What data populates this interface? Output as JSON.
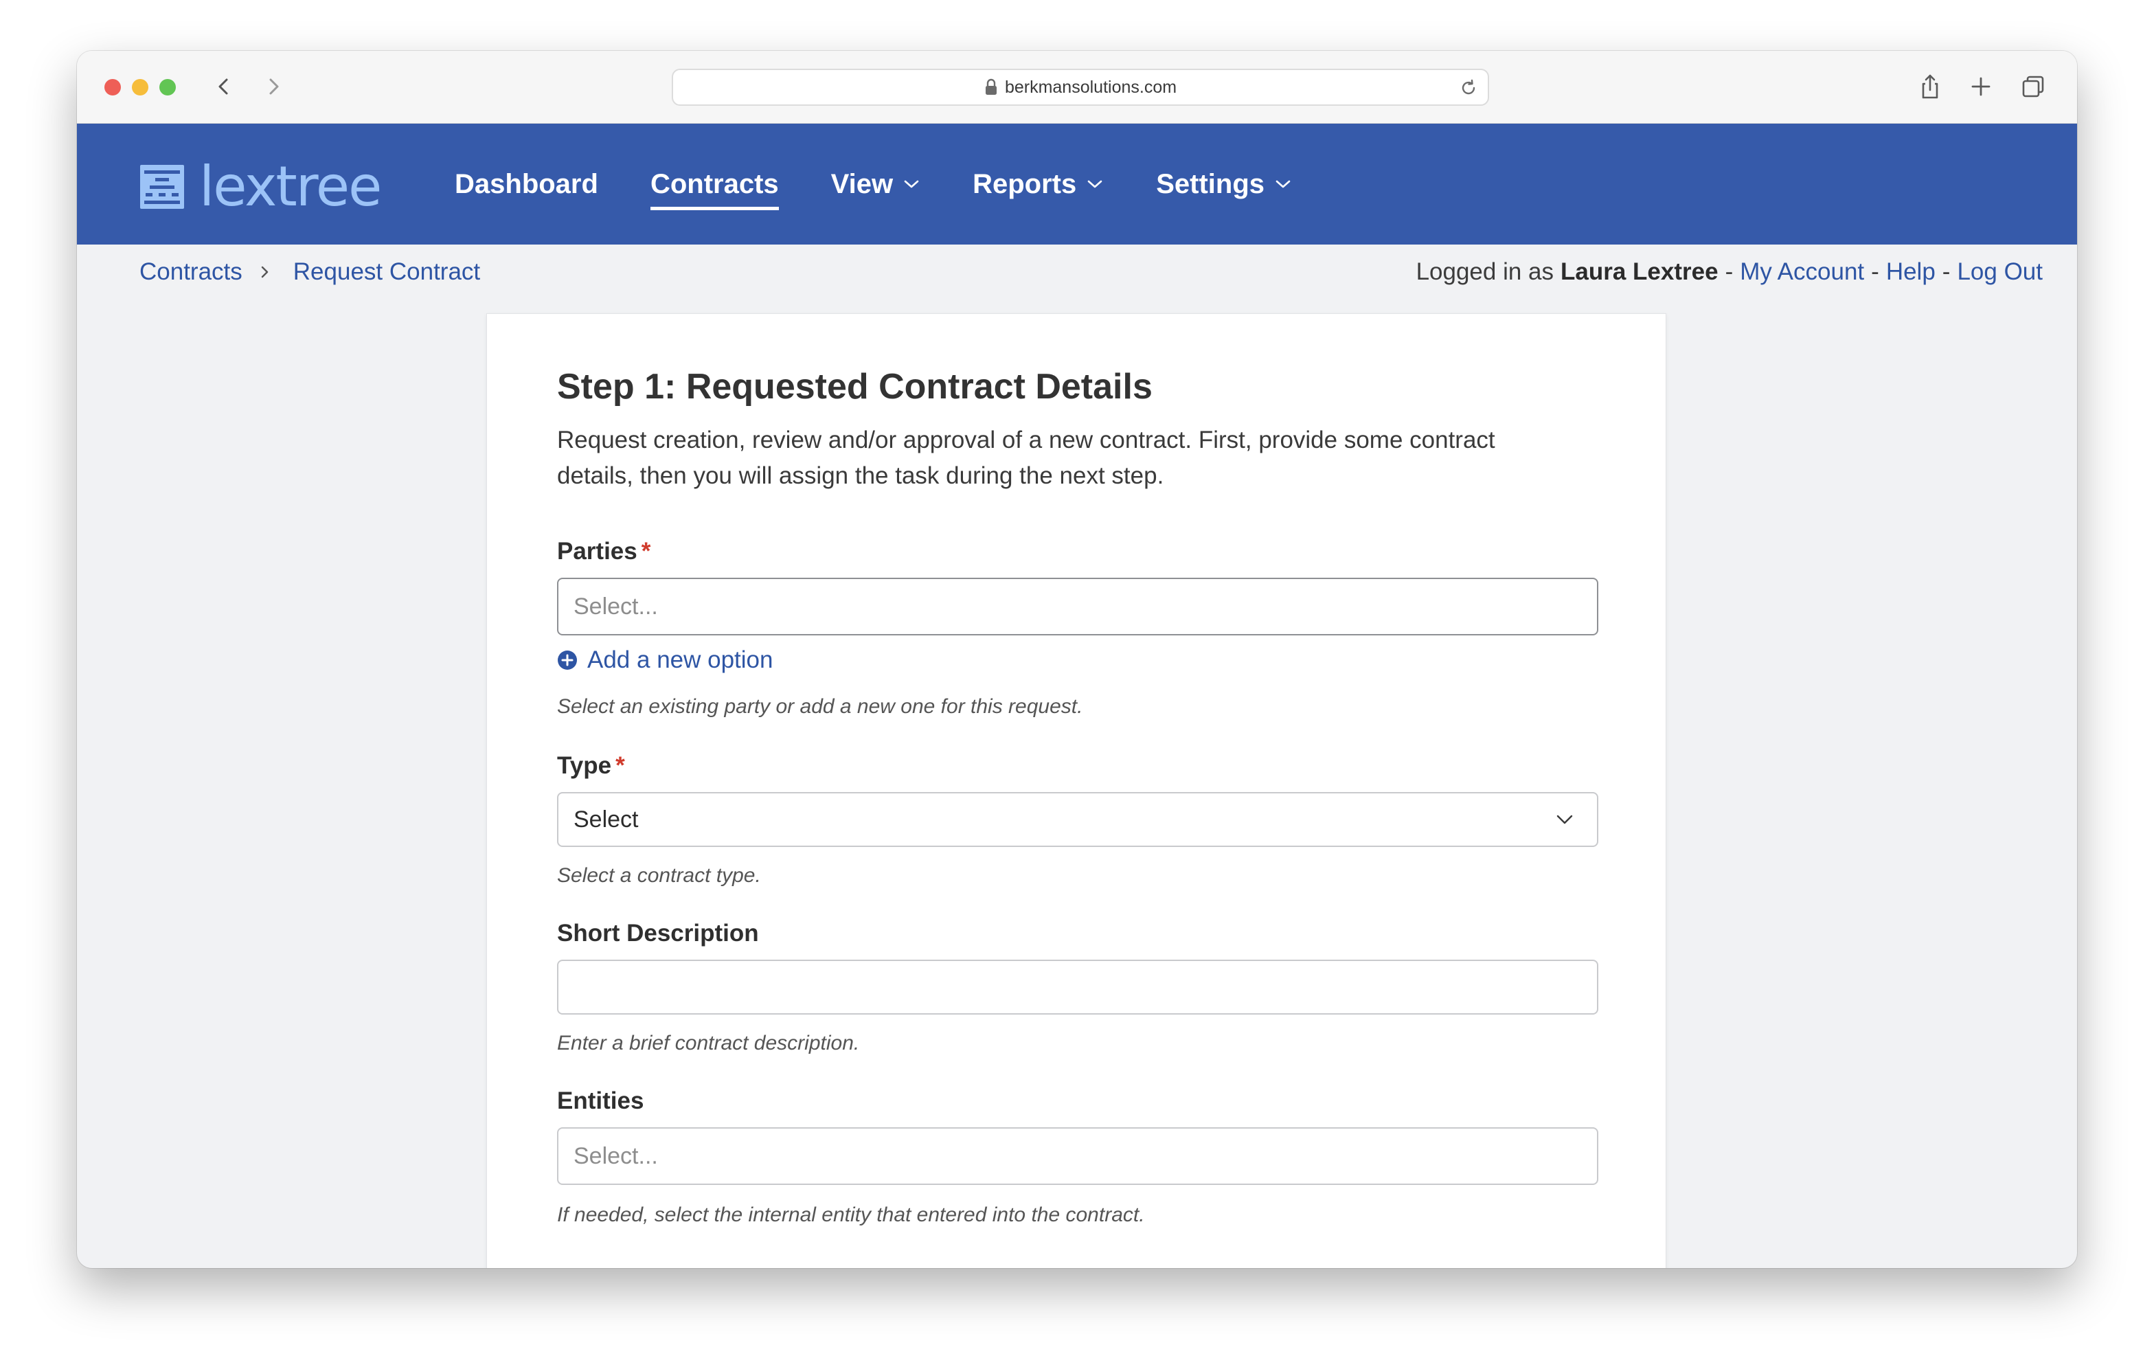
{
  "browser": {
    "url": "berkmansolutions.com",
    "icons": [
      "back-arrow-icon",
      "forward-arrow-icon",
      "lock-icon",
      "reload-icon",
      "share-icon",
      "new-tab-icon",
      "tabs-overview-icon"
    ]
  },
  "app": {
    "logo_text": "lextree",
    "brand_color": "#365aaa",
    "nav": {
      "dashboard": "Dashboard",
      "contracts": "Contracts",
      "view": "View",
      "reports": "Reports",
      "settings": "Settings"
    }
  },
  "breadcrumb": {
    "root": "Contracts",
    "current": "Request Contract"
  },
  "account": {
    "prefix": "Logged in as",
    "user": "Laura Lextree",
    "separator": "-",
    "my_account": "My Account",
    "help": "Help",
    "log_out": "Log Out"
  },
  "form": {
    "title": "Step 1: Requested Contract Details",
    "intro": "Request creation, review and/or approval of a new contract. First, provide some contract details, then you will assign the task during the next step.",
    "required_marker": "*",
    "parties": {
      "label": "Parties",
      "placeholder": "Select...",
      "add_option": "Add a new option",
      "help": "Select an existing party or add a new one for this request."
    },
    "type": {
      "label": "Type",
      "value": "Select",
      "help": "Select a contract type."
    },
    "short_description": {
      "label": "Short Description",
      "value": "",
      "help": "Enter a brief contract description."
    },
    "entities": {
      "label": "Entities",
      "placeholder": "Select...",
      "help": "If needed, select the internal entity that entered into the contract."
    }
  }
}
